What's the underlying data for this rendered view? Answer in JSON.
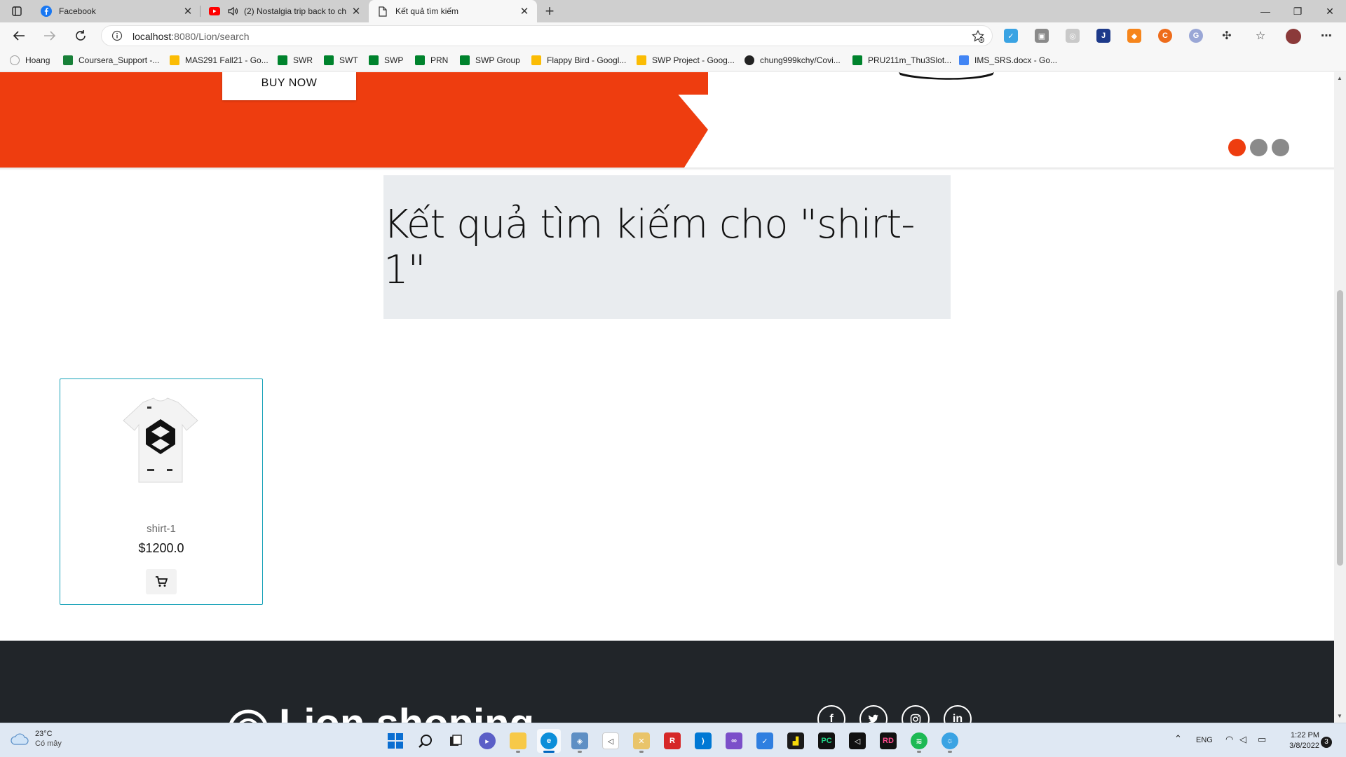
{
  "browser": {
    "tabs": [
      {
        "title": "Facebook",
        "icon": "facebook-icon"
      },
      {
        "title": "(2) Nostalgia trip back to ch",
        "icon": "youtube-icon"
      },
      {
        "title": "Kết quả tìm kiếm",
        "icon": "page-icon"
      }
    ],
    "url_host": "localhost",
    "url_rest": ":8080/Lion/search",
    "bookmarks": [
      {
        "label": "Hoang",
        "color": "#9e9e9e"
      },
      {
        "label": "Coursera_Support -...",
        "color": "#188038"
      },
      {
        "label": "MAS291 Fall21 - Go...",
        "color": "#fbbc04"
      },
      {
        "label": "SWR",
        "color": "#00832d"
      },
      {
        "label": "SWT",
        "color": "#00832d"
      },
      {
        "label": "SWP",
        "color": "#00832d"
      },
      {
        "label": "PRN",
        "color": "#00832d"
      },
      {
        "label": "SWP Group",
        "color": "#00832d"
      },
      {
        "label": "Flappy Bird - Googl...",
        "color": "#fbbc04"
      },
      {
        "label": "SWP Project - Goog...",
        "color": "#fbbc04"
      },
      {
        "label": "chung999kchy/Covi...",
        "color": "#222222"
      },
      {
        "label": "PRU211m_Thu3Slot...",
        "color": "#00832d"
      },
      {
        "label": "IMS_SRS.docx - Go...",
        "color": "#4285f4"
      }
    ]
  },
  "hero": {
    "buy_now": "BUY NOW",
    "slides": 3,
    "active_slide": 1
  },
  "search": {
    "title": "Kết quả tìm kiếm cho \"shirt-1\""
  },
  "products": [
    {
      "name": "shirt-1",
      "price": "$1200.0"
    }
  ],
  "footer": {
    "brand": "Lion shoping",
    "social": [
      "facebook-icon",
      "twitter-icon",
      "instagram-icon",
      "linkedin-icon"
    ]
  },
  "taskbar": {
    "temp": "23°C",
    "condition": "Có mây",
    "lang": "ENG",
    "time": "1:22 PM",
    "date": "3/8/2022",
    "notifications": "3"
  },
  "colors": {
    "accent": "#ee3d0f",
    "card_border": "#17a2b8",
    "footer_bg": "#212529",
    "result_bg": "#e9ecef"
  }
}
